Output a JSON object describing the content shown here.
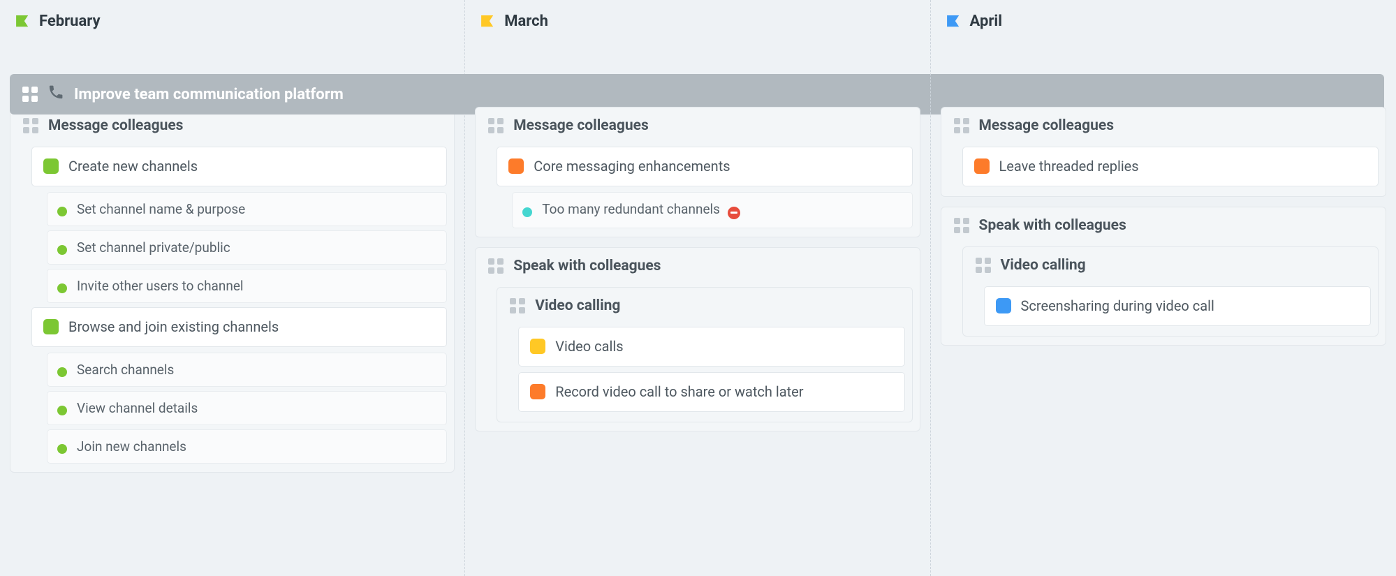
{
  "epic": {
    "title": "Improve team communication platform"
  },
  "colors": {
    "green": "#7cc733",
    "orange": "#fd7b2a",
    "yellow": "#ffc825",
    "teal": "#45d6d0",
    "blue": "#3d99f5"
  },
  "columns": [
    {
      "month": "February",
      "flag_color": "#7cc733",
      "groups": [
        {
          "title": "Message colleagues",
          "cards": [
            {
              "title": "Create new channels",
              "swatch": "green",
              "subs": [
                {
                  "title": "Set channel name & purpose",
                  "dot": "green"
                },
                {
                  "title": "Set channel private/public",
                  "dot": "green"
                },
                {
                  "title": "Invite other users to channel",
                  "dot": "green"
                }
              ]
            },
            {
              "title": "Browse and join existing channels",
              "swatch": "green",
              "subs": [
                {
                  "title": "Search channels",
                  "dot": "green"
                },
                {
                  "title": "View channel details",
                  "dot": "green"
                },
                {
                  "title": "Join new channels",
                  "dot": "green"
                }
              ]
            }
          ]
        }
      ]
    },
    {
      "month": "March",
      "flag_color": "#ffc825",
      "groups": [
        {
          "title": "Message colleagues",
          "cards": [
            {
              "title": "Core messaging enhancements",
              "swatch": "orange",
              "subs": [
                {
                  "title": "Too many redundant channels",
                  "dot": "teal",
                  "noentry": true,
                  "note": true
                }
              ]
            }
          ]
        },
        {
          "title": "Speak with colleagues",
          "subgroups": [
            {
              "title": "Video calling",
              "cards": [
                {
                  "title": "Video calls",
                  "swatch": "yellow"
                },
                {
                  "title": "Record video call to share or watch later",
                  "swatch": "orange"
                }
              ]
            }
          ]
        }
      ]
    },
    {
      "month": "April",
      "flag_color": "#3d99f5",
      "groups": [
        {
          "title": "Message colleagues",
          "cards": [
            {
              "title": "Leave threaded replies",
              "swatch": "orange"
            }
          ]
        },
        {
          "title": "Speak with colleagues",
          "subgroups": [
            {
              "title": "Video calling",
              "cards": [
                {
                  "title": "Screensharing during video call",
                  "swatch": "blue"
                }
              ]
            }
          ]
        }
      ]
    }
  ]
}
